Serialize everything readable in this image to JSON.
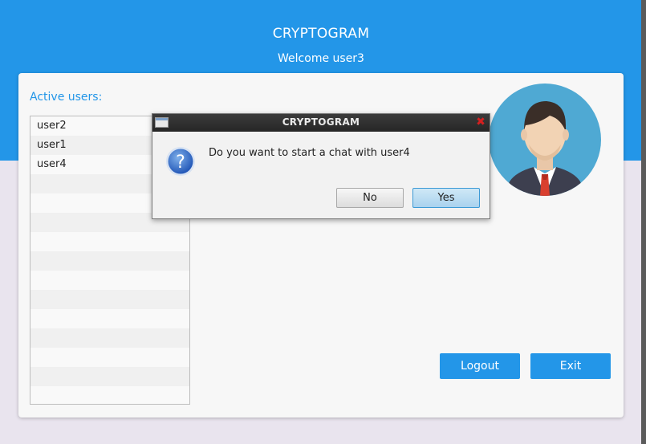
{
  "header": {
    "app_title": "CRYPTOGRAM",
    "welcome": "Welcome user3"
  },
  "sidebar": {
    "label": "Active users:",
    "users": [
      "user2",
      "user1",
      "user4"
    ]
  },
  "actions": {
    "logout_label": "Logout",
    "exit_label": "Exit"
  },
  "dialog": {
    "title": "CRYPTOGRAM",
    "message": "Do you want to start a chat with user4",
    "no_label": "No",
    "yes_label": "Yes",
    "icon": "question-icon"
  },
  "colors": {
    "accent": "#2396e8",
    "avatar_bg": "#4fa9d3"
  }
}
